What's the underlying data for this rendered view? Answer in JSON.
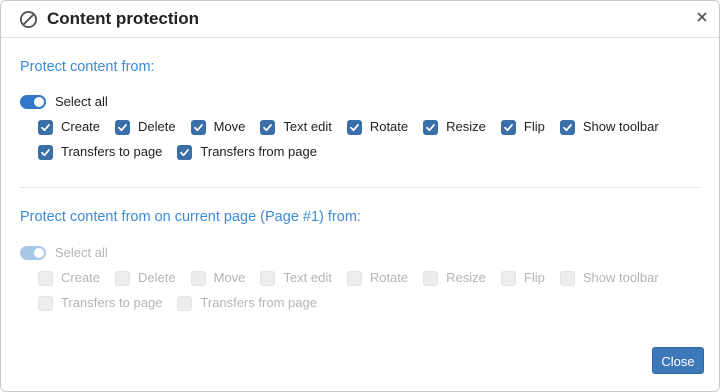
{
  "dialog": {
    "title": "Content protection",
    "title_icon": "ban-icon",
    "close_icon": "close-icon"
  },
  "section1": {
    "title": "Protect content from:",
    "select_all": {
      "label": "Select all",
      "on": true
    },
    "rows": [
      [
        {
          "label": "Create",
          "checked": true
        },
        {
          "label": "Delete",
          "checked": true
        },
        {
          "label": "Move",
          "checked": true
        },
        {
          "label": "Text edit",
          "checked": true
        },
        {
          "label": "Rotate",
          "checked": true
        },
        {
          "label": "Resize",
          "checked": true
        },
        {
          "label": "Flip",
          "checked": true
        },
        {
          "label": "Show toolbar",
          "checked": true
        }
      ],
      [
        {
          "label": "Transfers to page",
          "checked": true
        },
        {
          "label": "Transfers from page",
          "checked": true
        }
      ]
    ]
  },
  "section2": {
    "title": "Protect content from on current page (Page #1) from:",
    "disabled": true,
    "select_all": {
      "label": "Select all",
      "on": true
    },
    "rows": [
      [
        {
          "label": "Create",
          "checked": false
        },
        {
          "label": "Delete",
          "checked": false
        },
        {
          "label": "Move",
          "checked": false
        },
        {
          "label": "Text edit",
          "checked": false
        },
        {
          "label": "Rotate",
          "checked": false
        },
        {
          "label": "Resize",
          "checked": false
        },
        {
          "label": "Flip",
          "checked": false
        },
        {
          "label": "Show toolbar",
          "checked": false
        }
      ],
      [
        {
          "label": "Transfers to page",
          "checked": false
        },
        {
          "label": "Transfers from page",
          "checked": false
        }
      ]
    ]
  },
  "footer": {
    "close_label": "Close"
  },
  "colors": {
    "accent": "#3d8ad8",
    "checkbox": "#3a6fa8",
    "button": "#3d79b8",
    "disabled_text": "#b4b4b4"
  }
}
